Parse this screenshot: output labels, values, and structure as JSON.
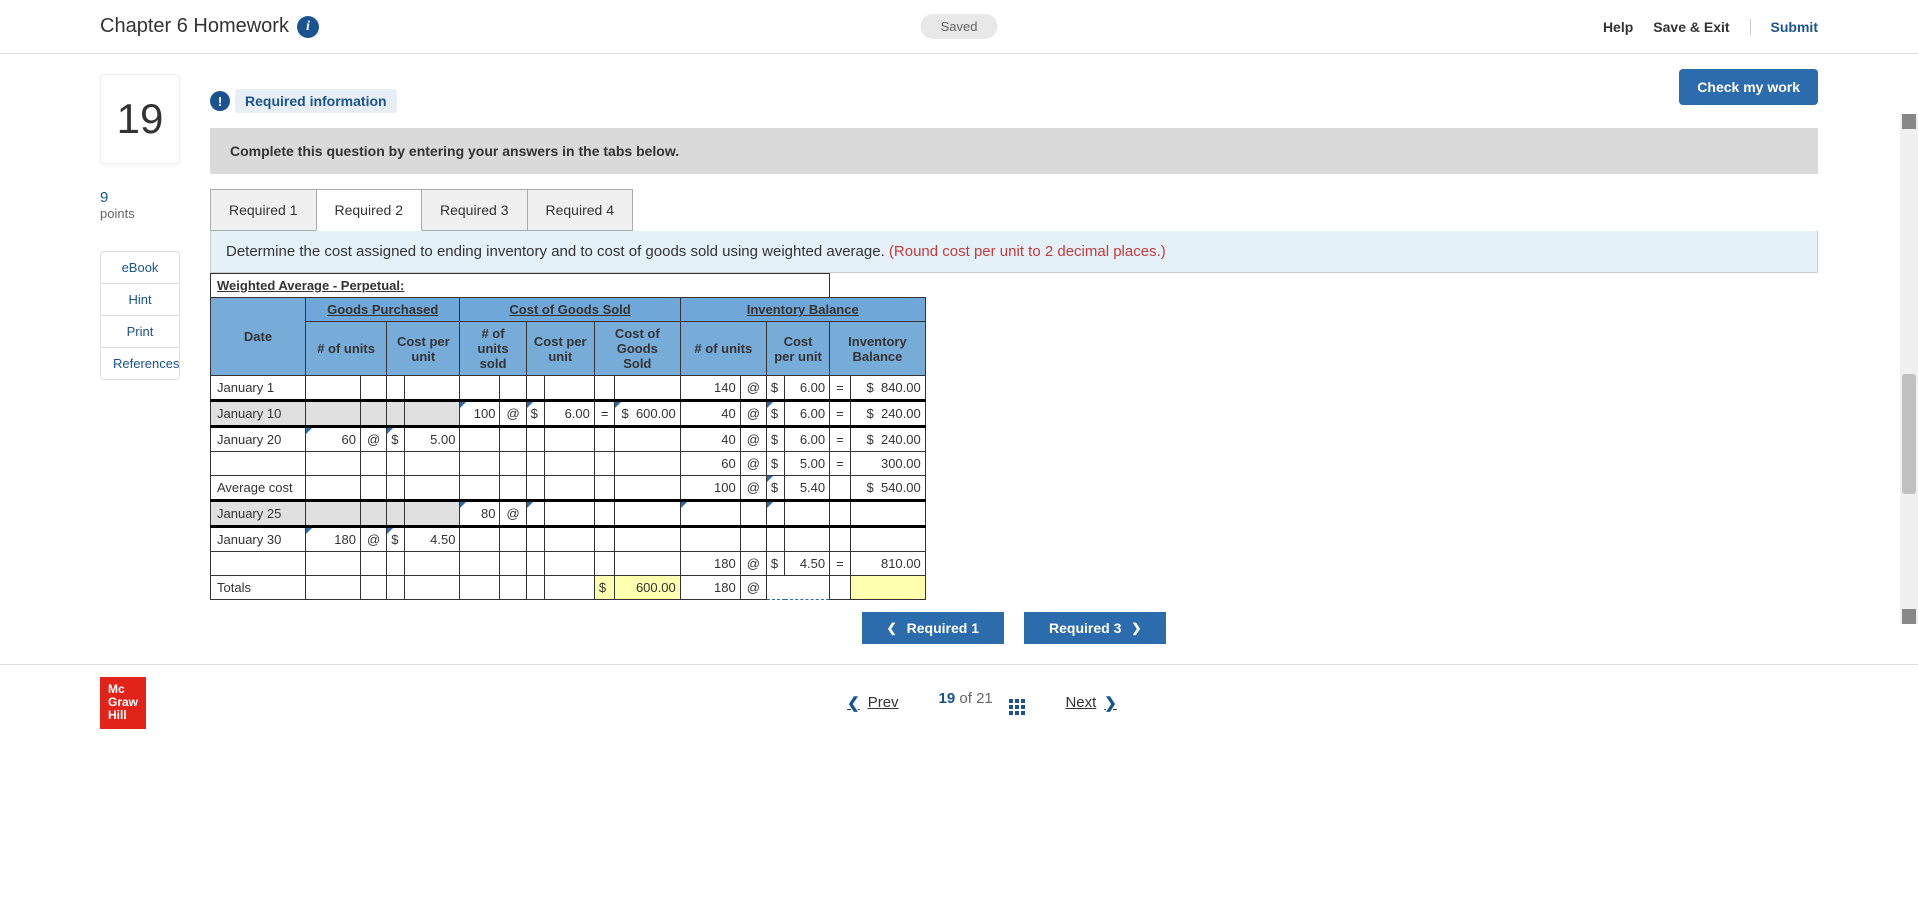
{
  "header": {
    "title": "Chapter 6 Homework",
    "saved": "Saved",
    "help": "Help",
    "save_exit": "Save & Exit",
    "submit": "Submit"
  },
  "question": {
    "number": "19",
    "points_value": "9",
    "points_label": "points"
  },
  "sidebar": {
    "ebook": "eBook",
    "hint": "Hint",
    "print": "Print",
    "references": "References"
  },
  "content": {
    "check_work": "Check my work",
    "req_info": "Required information",
    "instruction": "Complete this question by entering your answers in the tabs below.",
    "tabs": [
      "Required 1",
      "Required 2",
      "Required 3",
      "Required 4"
    ],
    "active_tab": 1,
    "tab_desc_main": "Determine the cost assigned to ending inventory and to cost of goods sold using weighted average. ",
    "tab_desc_red": "(Round cost per unit to 2 decimal places.)"
  },
  "table": {
    "title": "Weighted Average - Perpetual:",
    "section_headers": [
      "Goods Purchased",
      "Cost of Goods Sold",
      "Inventory Balance"
    ],
    "col_headers": {
      "date": "Date",
      "gp_units": "# of units",
      "gp_cost": "Cost per unit",
      "cogs_units": "# of units sold",
      "cogs_cost": "Cost per unit",
      "cogs_total": "Cost of Goods Sold",
      "ib_units": "# of units",
      "ib_cost": "Cost per unit",
      "ib_total": "Inventory Balance"
    },
    "rows": [
      {
        "date": "January 1",
        "ib_units": "140",
        "ib_at": "@",
        "ib_cur": "$",
        "ib_cost": "6.00",
        "ib_eq": "=",
        "ib_tcur": "$",
        "ib_total": "840.00"
      },
      {
        "date": "January 10",
        "cogs_units": "100",
        "cogs_at": "@",
        "cogs_cur": "$",
        "cogs_cost": "6.00",
        "cogs_eq": "=",
        "cogs_tcur": "$",
        "cogs_total": "600.00",
        "ib_units": "40",
        "ib_at": "@",
        "ib_cur": "$",
        "ib_cost": "6.00",
        "ib_eq": "=",
        "ib_tcur": "$",
        "ib_total": "240.00",
        "gray": true
      },
      {
        "date": "January 20",
        "gp_units": "60",
        "gp_at": "@",
        "gp_cur": "$",
        "gp_cost": "5.00",
        "ib_units": "40",
        "ib_at": "@",
        "ib_cur": "$",
        "ib_cost": "6.00",
        "ib_eq": "=",
        "ib_tcur": "$",
        "ib_total": "240.00"
      },
      {
        "date": "",
        "ib_units": "60",
        "ib_at": "@",
        "ib_cur": "$",
        "ib_cost": "5.00",
        "ib_eq": "=",
        "ib_total": "300.00"
      },
      {
        "date": "Average cost",
        "ib_units": "100",
        "ib_at": "@",
        "ib_cur": "$",
        "ib_cost": "5.40",
        "ib_tcur": "$",
        "ib_total": "540.00"
      },
      {
        "date": "January 25",
        "cogs_units": "80",
        "cogs_at": "@",
        "gray": true
      },
      {
        "date": "January 30",
        "gp_units": "180",
        "gp_at": "@",
        "gp_cur": "$",
        "gp_cost": "4.50"
      },
      {
        "date": "",
        "ib_units": "180",
        "ib_at": "@",
        "ib_cur": "$",
        "ib_cost": "4.50",
        "ib_eq": "=",
        "ib_total": "810.00"
      },
      {
        "date": "Totals",
        "cogs_tcur": "$",
        "cogs_total": "600.00",
        "ib_units": "180",
        "ib_at": "@",
        "yellow_cogs": true,
        "yellow_ib": true
      }
    ]
  },
  "nav_buttons": {
    "prev": "Required 1",
    "next": "Required 3"
  },
  "footer": {
    "logo1": "Mc",
    "logo2": "Graw",
    "logo3": "Hill",
    "prev": "Prev",
    "current": "19",
    "of": "of",
    "total": "21",
    "next": "Next"
  }
}
